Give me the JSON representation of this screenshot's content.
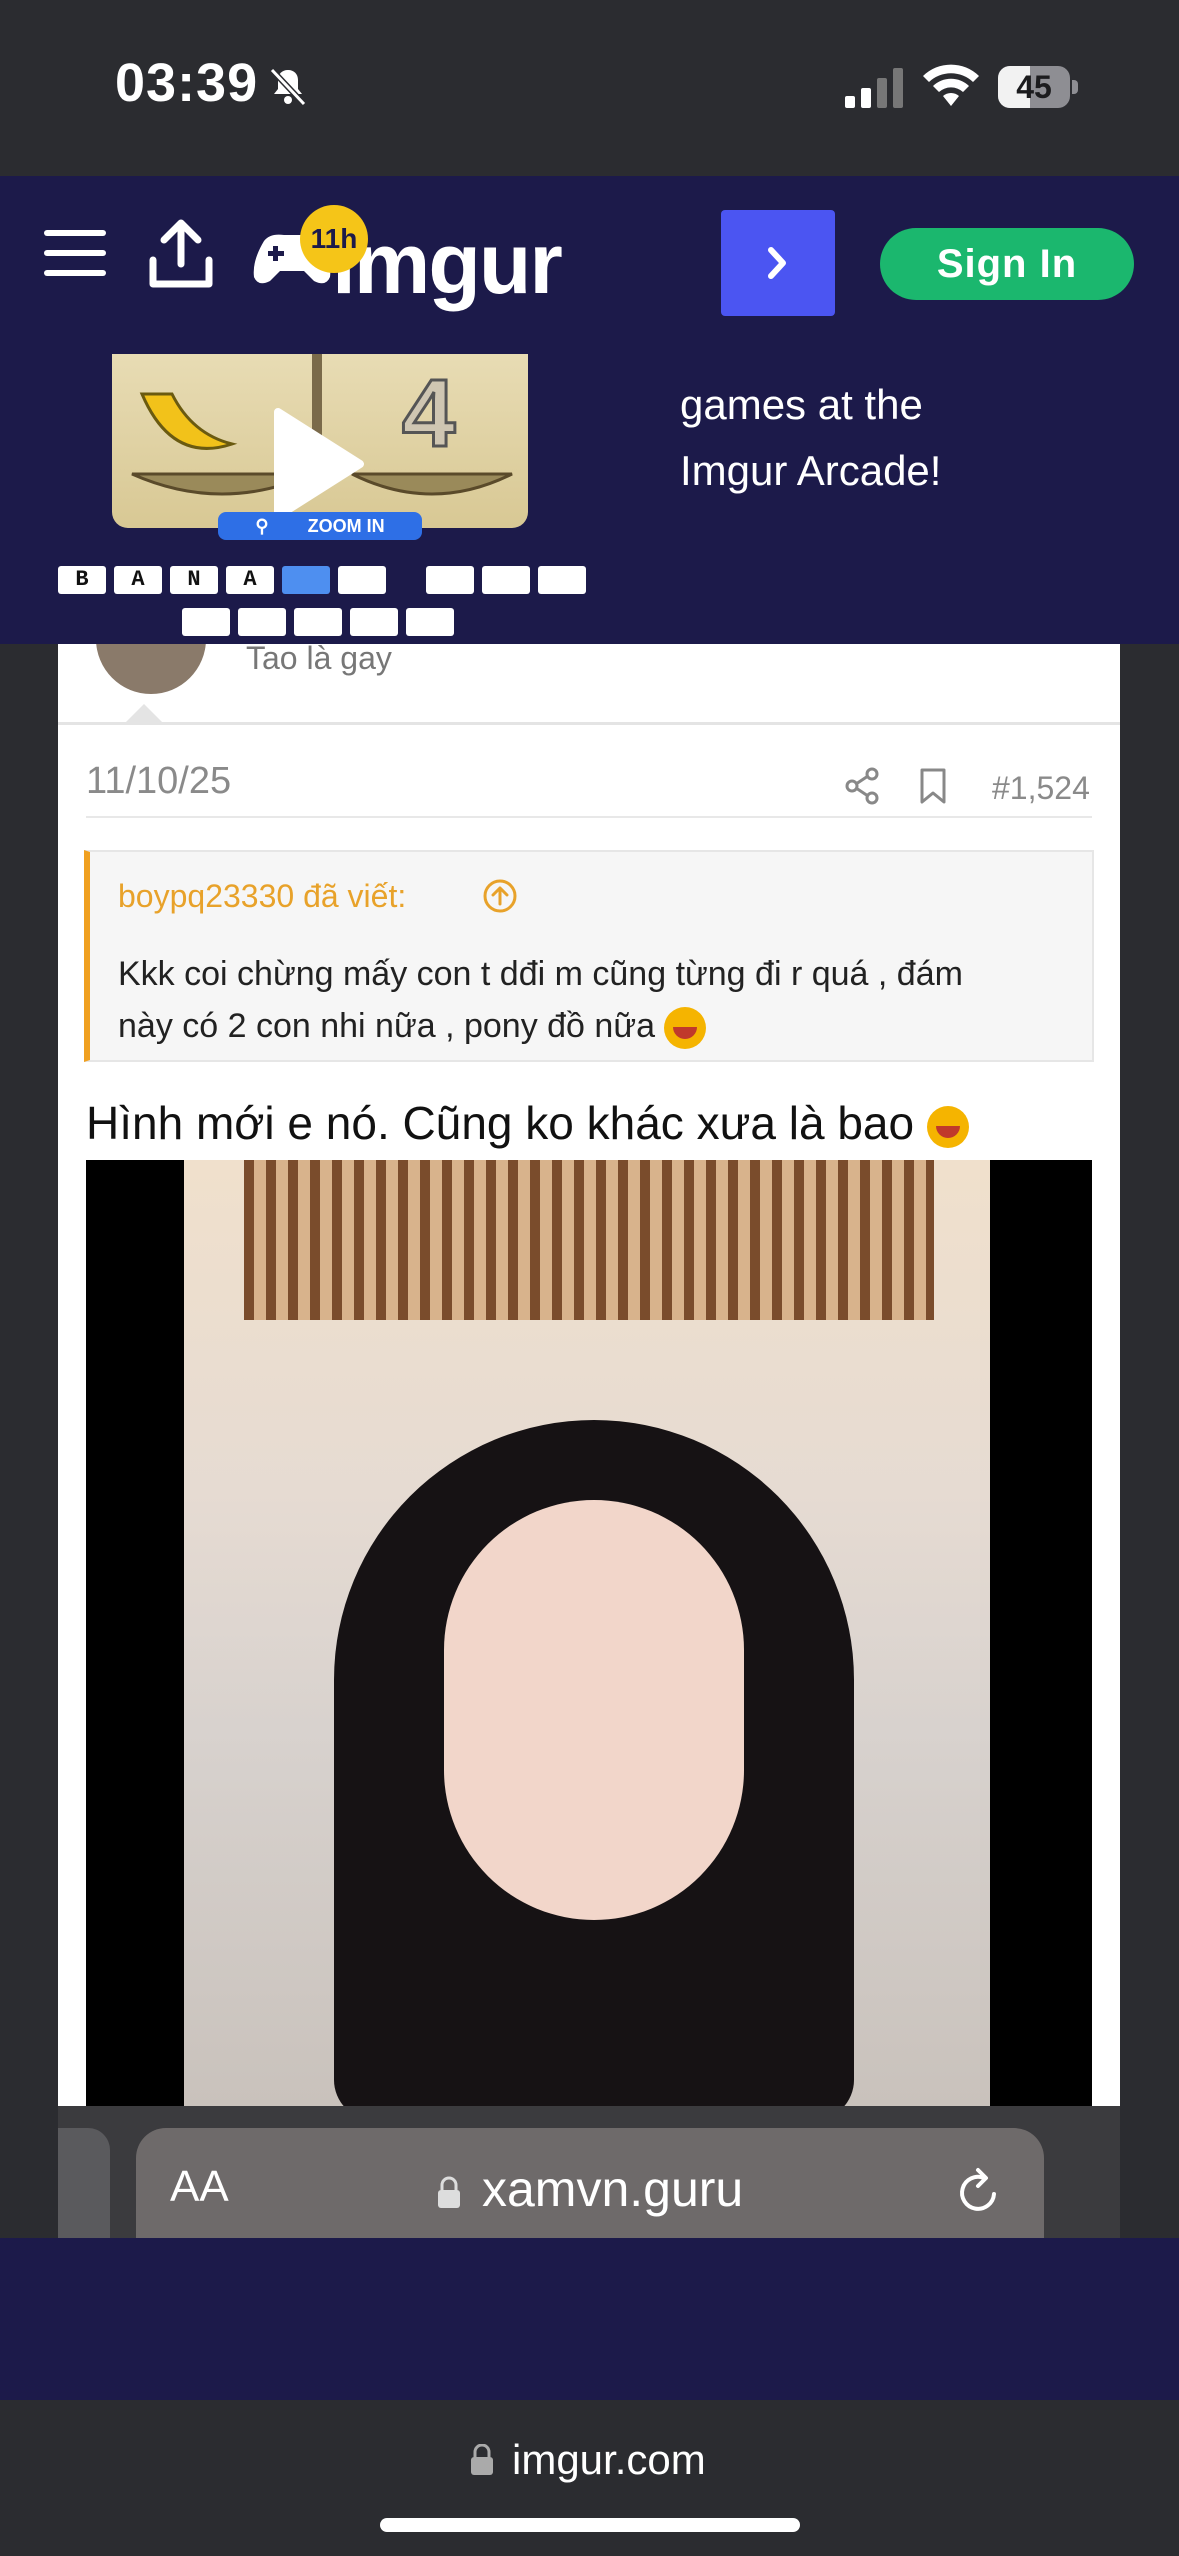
{
  "status_bar": {
    "time": "03:39",
    "battery": "45",
    "battery_level": 0.45
  },
  "header": {
    "logo_text": "imgur",
    "logo_badge": "11h",
    "signin_label": "Sign In",
    "next_icon": "chevron-right-icon"
  },
  "ad": {
    "text_line1": "games at the",
    "text_line2": "Imgur Arcade!",
    "zoom_label": "ZOOM IN",
    "scale_number": "4",
    "tiles_row1": [
      "B",
      "A",
      "N",
      "A"
    ]
  },
  "post": {
    "user_subtitle": "Tao là gay",
    "date": "11/10/25",
    "number": "#1,524",
    "quote_author": "boypq23330 đã viết:",
    "quote_line1": "Kkk coi chừng mấy con t dđi m cũng từng đi r quá , đám",
    "quote_line2": "này có 2 con nhi nữa , pony đồ nữa",
    "message": "Hình mới e nó. Cũng ko khác xưa là bao"
  },
  "inner_browser": {
    "aa_label": "AA",
    "url": "xamvn.guru"
  },
  "browser": {
    "url": "imgur.com"
  },
  "colors": {
    "navy": "#1c1a4a",
    "signin_green": "#1bb76e",
    "next_blue": "#4b55f2",
    "quote_accent": "#f0a020"
  }
}
